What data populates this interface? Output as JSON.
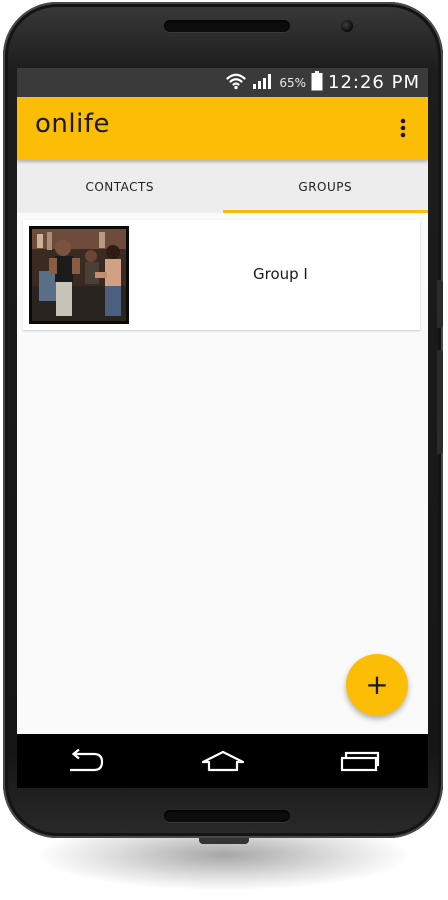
{
  "status_bar": {
    "battery_percent": "65%",
    "time": "12:26 PM",
    "icons": [
      "wifi-icon",
      "signal-icon",
      "battery-icon"
    ]
  },
  "app_bar": {
    "title": "onlife",
    "menu_icon": "more-vert-icon"
  },
  "tabs": [
    {
      "label": "CONTACTS",
      "active": false
    },
    {
      "label": "GROUPS",
      "active": true
    }
  ],
  "groups": [
    {
      "name": "Group I",
      "thumbnail": "group-photo"
    }
  ],
  "fab": {
    "label": "+",
    "icon": "add-icon"
  },
  "navigation": {
    "buttons": [
      "back-icon",
      "home-icon",
      "recents-icon"
    ]
  },
  "colors": {
    "accent": "#fbbd05",
    "status_bar": "#3a3a3a",
    "tab_bar": "#ededed",
    "background": "#fafafa",
    "nav_bar": "#000000"
  }
}
